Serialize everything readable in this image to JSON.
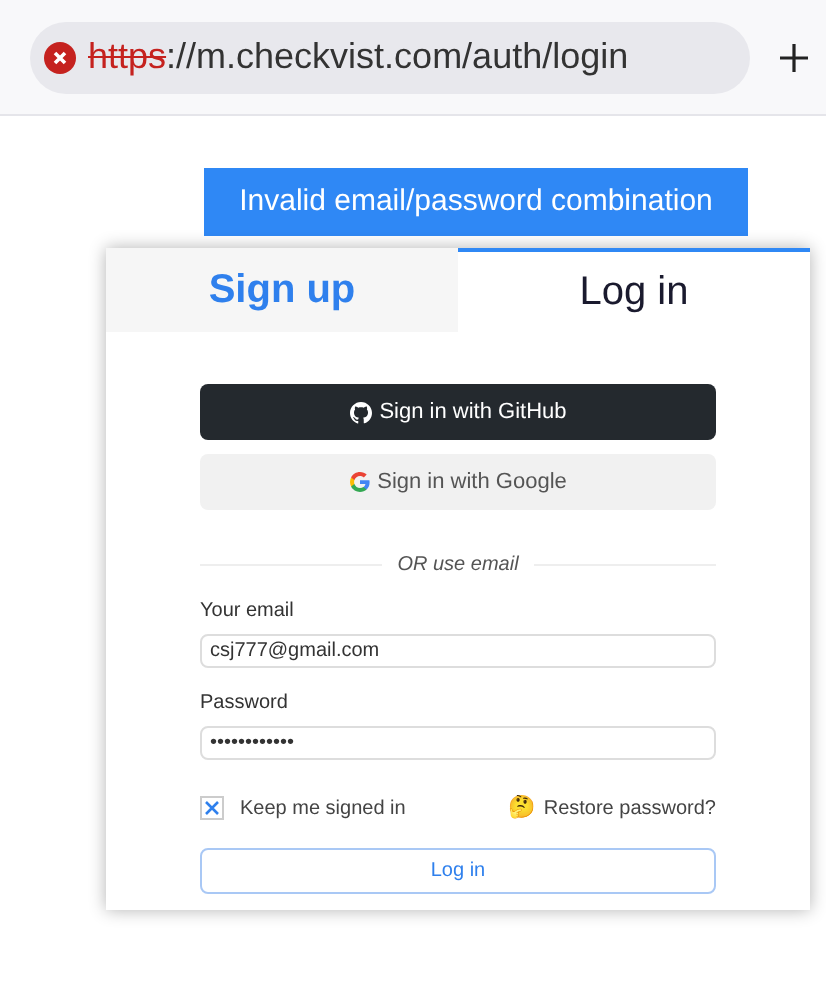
{
  "address_bar": {
    "secure": false,
    "scheme": "https",
    "rest": "://m.checkvist.com/auth/login"
  },
  "error_banner": "Invalid email/password combination",
  "tabs": [
    {
      "label": "Sign up",
      "selected": false
    },
    {
      "label": "Log in",
      "selected": true
    }
  ],
  "social_buttons": [
    {
      "kind": "github",
      "label": "Sign in with GitHub"
    },
    {
      "kind": "google",
      "label": "Sign in with Google"
    }
  ],
  "divider": "OR use email",
  "fields": [
    {
      "label": "Your email",
      "value": "csj777@gmail.com"
    },
    {
      "label": "Password",
      "value": "••••••••••••"
    }
  ],
  "keep_signed_in": {
    "label": "Keep me signed in",
    "checked": true
  },
  "restore": {
    "emoji": "🤔",
    "label": "Restore password?"
  },
  "submit": "Log in"
}
